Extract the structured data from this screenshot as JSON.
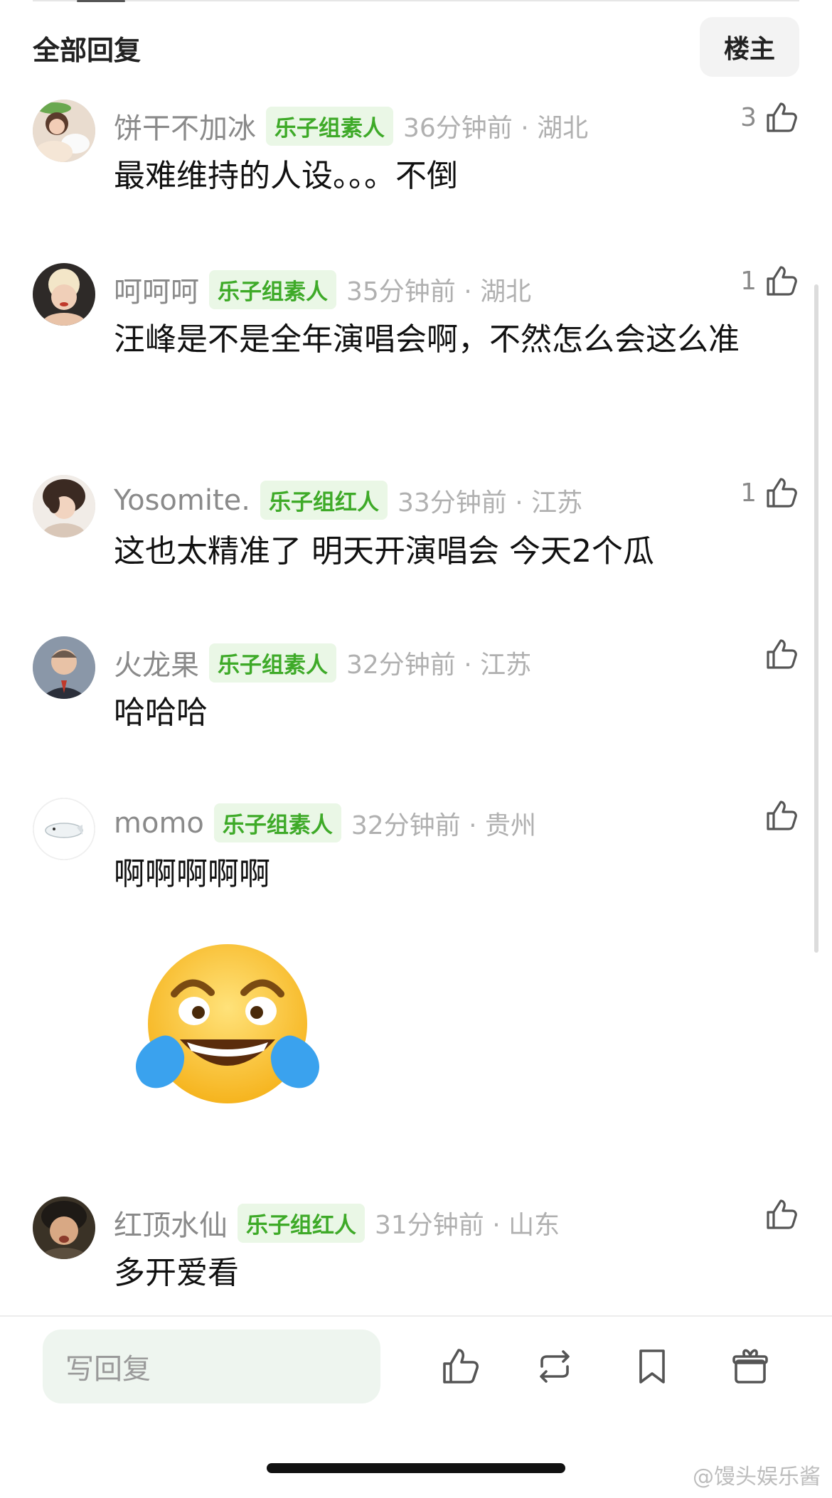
{
  "header": {
    "title": "全部回复",
    "louzhu_label": "楼主"
  },
  "comments": [
    {
      "username": "饼干不加冰",
      "badge": "乐子组素人",
      "time_location": "36分钟前 · 湖北",
      "likes": "3",
      "text": "最难维持的人设。。。不倒"
    },
    {
      "username": "呵呵呵",
      "badge": "乐子组素人",
      "time_location": "35分钟前 · 湖北",
      "likes": "1",
      "text": "汪峰是不是全年演唱会啊，不然怎么会这么准"
    },
    {
      "username": "Yosomite.",
      "badge": "乐子组红人",
      "time_location": "33分钟前 · 江苏",
      "likes": "1",
      "text": "这也太精准了  明天开演唱会  今天2个瓜"
    },
    {
      "username": "火龙果",
      "badge": "乐子组素人",
      "time_location": "32分钟前 · 江苏",
      "likes": "",
      "text": "哈哈哈"
    },
    {
      "username": "momo",
      "badge": "乐子组素人",
      "time_location": "32分钟前 · 贵州",
      "likes": "",
      "text": "啊啊啊啊啊"
    },
    {
      "username": "红顶水仙",
      "badge": "乐子组红人",
      "time_location": "31分钟前 · 山东",
      "likes": "",
      "text": "多开爱看"
    }
  ],
  "bottom_bar": {
    "reply_placeholder": "写回复"
  },
  "watermark": "@馒头娱乐酱",
  "colors": {
    "badge_bg": "#eaf7e6",
    "badge_text": "#3eaa28",
    "reply_bg": "#eef5ef"
  },
  "icons": [
    "thumbs-up-icon",
    "repost-icon",
    "bookmark-icon",
    "gift-icon",
    "laughing-crying-emoji"
  ]
}
